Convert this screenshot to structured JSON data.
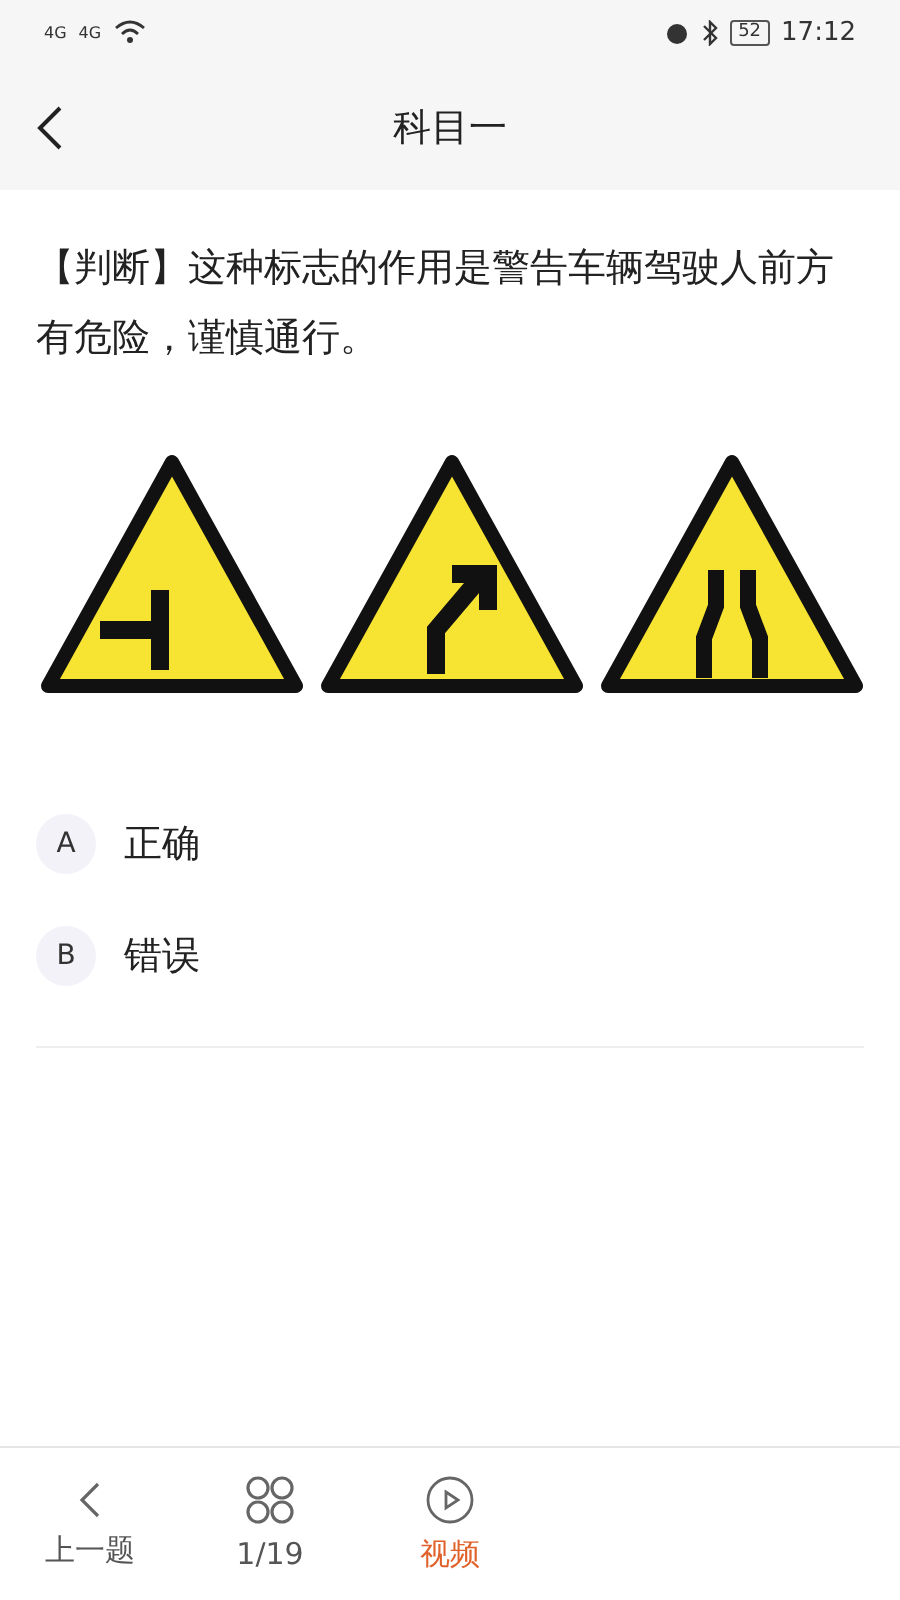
{
  "status_bar": {
    "network_left": [
      "4G",
      "4G"
    ],
    "battery": "52",
    "time": "17:12"
  },
  "header": {
    "title": "科目一"
  },
  "question": {
    "text": "【判断】这种标志的作用是警告车辆驾驶人前方有危险，谨慎通行。",
    "signs": [
      {
        "kind": "side-road"
      },
      {
        "kind": "curve"
      },
      {
        "kind": "narrow"
      }
    ]
  },
  "options": [
    {
      "letter": "A",
      "text": "正确",
      "selected": false
    },
    {
      "letter": "B",
      "text": "错误",
      "selected": false
    }
  ],
  "bottom_nav": [
    {
      "kind": "prev",
      "label": "上一题",
      "selected": false
    },
    {
      "kind": "grid",
      "label": "1/19",
      "selected": false
    },
    {
      "kind": "play",
      "label": "视频",
      "selected": true
    }
  ]
}
